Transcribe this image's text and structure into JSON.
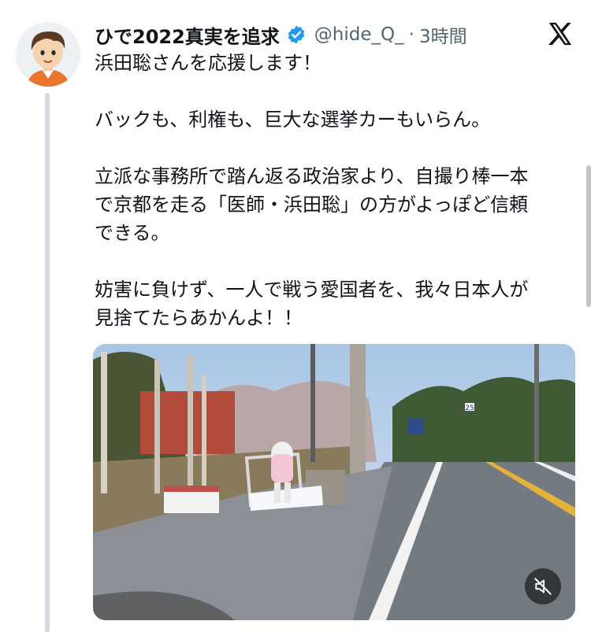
{
  "tweet": {
    "author_name": "ひで2022真実を追求",
    "handle": "@hide_Q_",
    "separator": "·",
    "time": "3時間",
    "verified_icon": "verified-badge-icon",
    "text_lines": [
      "浜田聡さんを応援します！",
      "",
      "バックも、利権も、巨大な選挙カーもいらん。",
      "",
      "立派な事務所で踏ん返る政治家より、自撮り棒一本",
      "で京都を走る「医師・浜田聡」の方がよっぽど信頼",
      "できる。",
      "",
      "妨害に負けず、一人で戦う愛国者を、我々日本人が",
      "見捨てたらあかんよ！！"
    ]
  },
  "media": {
    "type": "video",
    "mute_icon": "muted-speaker-icon",
    "road_sign_number": "25"
  },
  "icons": {
    "platform_logo": "x-logo-icon",
    "avatar": "cartoon-avatar"
  },
  "colors": {
    "verified_blue": "#1d9bf0",
    "secondary_text": "#536471",
    "thread_line": "#cfd9de"
  }
}
